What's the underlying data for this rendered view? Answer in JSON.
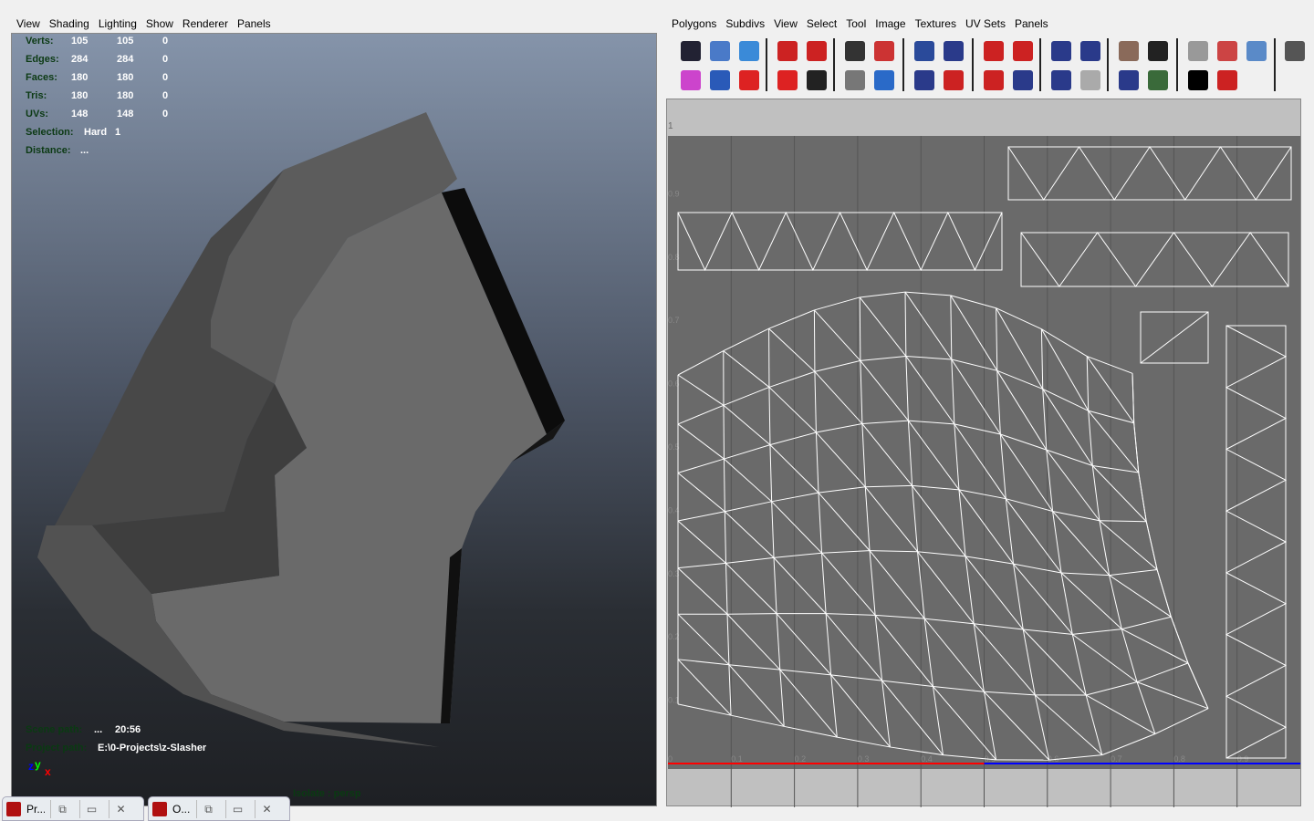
{
  "left_panel": {
    "menu": [
      "View",
      "Shading",
      "Lighting",
      "Show",
      "Renderer",
      "Panels"
    ],
    "hud": [
      {
        "label": "Verts:",
        "a": "105",
        "b": "105",
        "c": "0"
      },
      {
        "label": "Edges:",
        "a": "284",
        "b": "284",
        "c": "0"
      },
      {
        "label": "Faces:",
        "a": "180",
        "b": "180",
        "c": "0"
      },
      {
        "label": "Tris:",
        "a": "180",
        "b": "180",
        "c": "0"
      },
      {
        "label": "UVs:",
        "a": "148",
        "b": "148",
        "c": "0"
      }
    ],
    "selection": {
      "label": "Selection:",
      "value": "Hard",
      "count": "1"
    },
    "distance": {
      "label": "Distance:",
      "value": "..."
    },
    "scene_path": {
      "label": "Scene path:",
      "value": "...",
      "time": "20:56"
    },
    "project_path": {
      "label": "Project path:",
      "value": "E:\\0-Projects\\z-Slasher"
    },
    "axis": {
      "z": "z",
      "y": "y",
      "x": "x"
    },
    "isolate": "Isolate : persp"
  },
  "right_panel": {
    "menu": [
      "Polygons",
      "Subdivs",
      "View",
      "Select",
      "Tool",
      "Image",
      "Textures",
      "UV Sets",
      "Panels"
    ],
    "ruler_top_label": "1",
    "u_ticks": [
      "0",
      "0.1",
      "0.2",
      "0.3",
      "0.4",
      "0.5",
      "0.6",
      "0.7",
      "0.8",
      "0.9"
    ],
    "v_ticks": [
      "0.9",
      "0.8",
      "0.7",
      "0.6",
      "0.5",
      "0.4",
      "0.3",
      "0.2",
      "0.1"
    ],
    "toolbar_icons": [
      [
        "checker-uv-icon",
        "#223",
        "blue-arrow-icon",
        "#4a7ac8",
        "unfold-icon",
        "#3a8ad8",
        "rotate-uv-left-icon",
        "#c22",
        "rotate-uv-right-icon",
        "#c22",
        "checker-cut-icon",
        "#333",
        "shrink-icon",
        "#c33",
        "move-sew-icon",
        "#2a4a9a",
        "grid-left-icon",
        "#2a3a8a",
        "align-left-icon",
        "#c22",
        "align-right-icon",
        "#c22",
        "grid-icon",
        "#2a3a8a",
        "grid-add-icon",
        "#2a3a8a",
        "face-icon",
        "#8a6a5a",
        "checker-small-icon",
        "#222",
        "grid-grey-icon",
        "#999",
        "head-red-icon",
        "#c44",
        "overlap-icon",
        "#5a8ac8",
        "person-icon",
        "#555"
      ],
      [
        "uv-select-icon",
        "#c4c",
        "grid-cursor-icon",
        "#2a5ab8",
        "rotate-ccw-icon",
        "#d22",
        "rotate-cw-icon",
        "#d22",
        "checker-icon",
        "#222",
        "checker-grey-icon",
        "#777",
        "layout-icon",
        "#2a6ac8",
        "grid-yellow-icon",
        "#2a3a8a",
        "align-bottom-icon",
        "#c22",
        "align-top-icon",
        "#c22",
        "grid-circle-icon",
        "#2a3a8a",
        "grid-minus-icon",
        "#2a3a8a",
        "face-grey-icon",
        "#aaa",
        "split-icon",
        "#2a3a8a",
        "rgb-sphere-icon",
        "#3a6a3a",
        "white-circle-icon",
        "#000",
        "redo-icon",
        "#c22"
      ]
    ],
    "colors": {
      "u_axis_red": "#ff0000",
      "u_axis_blue": "#0000ff",
      "uv_background": "#6a6a6a",
      "uv_wire": "#ffffff"
    }
  },
  "taskbar": [
    {
      "label": "Pr..."
    },
    {
      "label": "O..."
    }
  ]
}
